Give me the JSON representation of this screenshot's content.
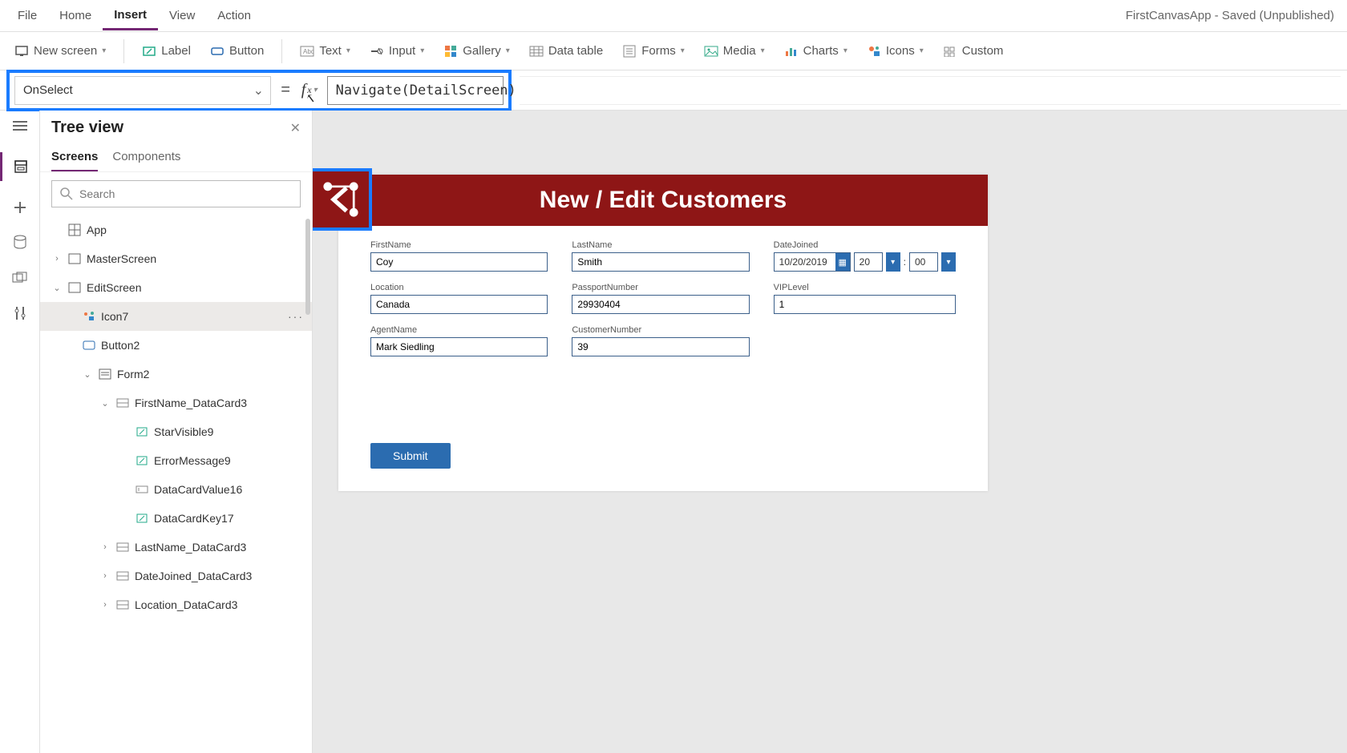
{
  "appTitle": "FirstCanvasApp - Saved (Unpublished)",
  "menu": {
    "file": "File",
    "home": "Home",
    "insert": "Insert",
    "view": "View",
    "action": "Action"
  },
  "ribbon": {
    "newScreen": "New screen",
    "label": "Label",
    "button": "Button",
    "text": "Text",
    "input": "Input",
    "gallery": "Gallery",
    "dataTable": "Data table",
    "forms": "Forms",
    "media": "Media",
    "charts": "Charts",
    "icons": "Icons",
    "custom": "Custom"
  },
  "formula": {
    "property": "OnSelect",
    "expression": "Navigate(DetailScreen)"
  },
  "treePanel": {
    "title": "Tree view",
    "tabScreens": "Screens",
    "tabComponents": "Components",
    "searchPlaceholder": "Search",
    "nodes": {
      "app": "App",
      "master": "MasterScreen",
      "edit": "EditScreen",
      "icon7": "Icon7",
      "button2": "Button2",
      "form2": "Form2",
      "firstNameCard": "FirstName_DataCard3",
      "starVisible": "StarVisible9",
      "errorMsg": "ErrorMessage9",
      "dcv16": "DataCardValue16",
      "dck17": "DataCardKey17",
      "lastNameCard": "LastName_DataCard3",
      "dateJoinedCard": "DateJoined_DataCard3",
      "locationCard": "Location_DataCard3"
    }
  },
  "form": {
    "title": "New / Edit Customers",
    "fields": {
      "firstName": {
        "label": "FirstName",
        "value": "Coy"
      },
      "lastName": {
        "label": "LastName",
        "value": "Smith"
      },
      "dateJoined": {
        "label": "DateJoined",
        "date": "10/20/2019",
        "hh": "20",
        "mm": "00"
      },
      "location": {
        "label": "Location",
        "value": "Canada"
      },
      "passport": {
        "label": "PassportNumber",
        "value": "29930404"
      },
      "vip": {
        "label": "VIPLevel",
        "value": "1"
      },
      "agent": {
        "label": "AgentName",
        "value": "Mark Siedling"
      },
      "custNum": {
        "label": "CustomerNumber",
        "value": "39"
      }
    },
    "submit": "Submit"
  }
}
